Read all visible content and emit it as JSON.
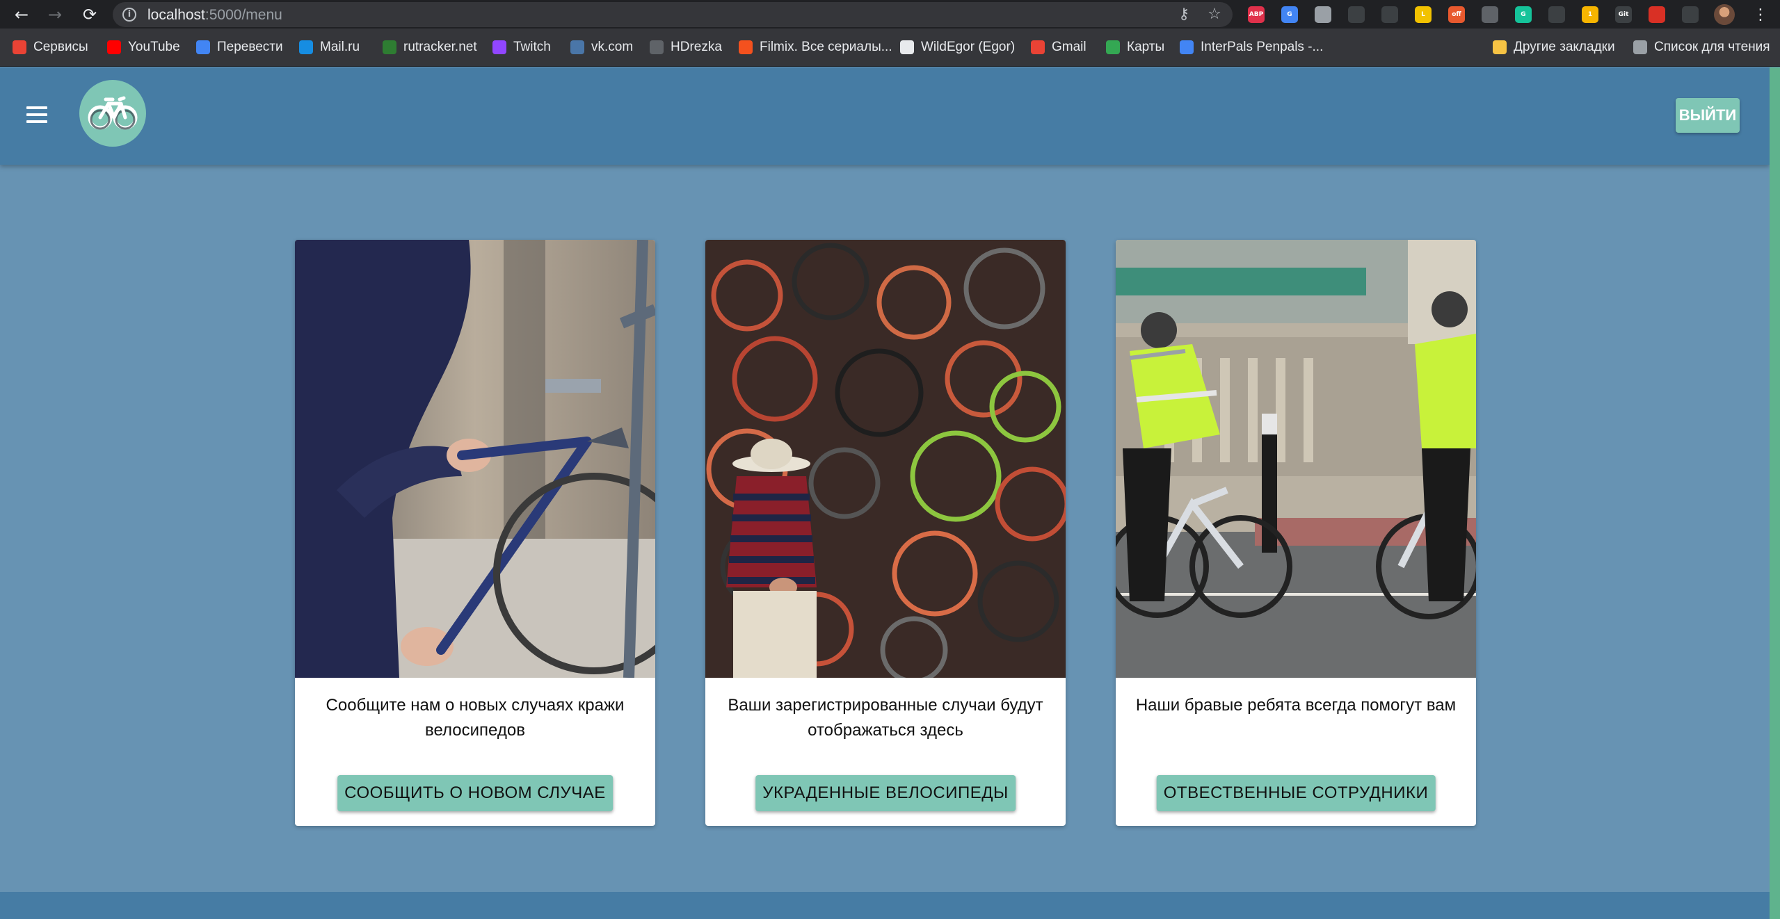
{
  "browser": {
    "url_host": "localhost",
    "url_path": ":5000/menu",
    "extensions": [
      {
        "name": "adblock-plus-icon",
        "label": "ABP",
        "color": "#e0314b"
      },
      {
        "name": "google-translate-icon",
        "label": "G",
        "color": "#4285f4"
      },
      {
        "name": "extension-gray-icon",
        "label": "",
        "color": "#9aa0a6"
      },
      {
        "name": "picture-in-picture-icon",
        "label": "",
        "color": "#3c4043"
      },
      {
        "name": "eyedropper-icon",
        "label": "",
        "color": "#3c4043"
      },
      {
        "name": "l-extension-icon",
        "label": "L",
        "color": "#f2c200"
      },
      {
        "name": "off-extension-icon",
        "label": "off",
        "color": "#e8592e"
      },
      {
        "name": "record-icon",
        "label": "",
        "color": "#5f6368"
      },
      {
        "name": "grammarly-icon",
        "label": "G",
        "color": "#15c39a"
      },
      {
        "name": "reader-icon",
        "label": "",
        "color": "#3c4043"
      },
      {
        "name": "badge-extension-icon",
        "label": "1",
        "color": "#f7b500"
      },
      {
        "name": "gitzip-icon",
        "label": "Git",
        "color": "#3c4043"
      },
      {
        "name": "red-extension-icon",
        "label": "",
        "color": "#d93025"
      },
      {
        "name": "puzzle-icon",
        "label": "",
        "color": "#3c4043"
      }
    ]
  },
  "bookmarks": [
    {
      "name": "bookmark-services",
      "label": "Сервисы",
      "color": "#ea4335"
    },
    {
      "name": "bookmark-youtube",
      "label": "YouTube",
      "color": "#ff0000"
    },
    {
      "name": "bookmark-translate",
      "label": "Перевести",
      "color": "#4285f4"
    },
    {
      "name": "bookmark-mailru",
      "label": "Mail.ru",
      "color": "#168de2"
    },
    {
      "name": "bookmark-rutracker",
      "label": "rutracker.net",
      "color": "#2e7d32"
    },
    {
      "name": "bookmark-twitch",
      "label": "Twitch",
      "color": "#9146ff"
    },
    {
      "name": "bookmark-vk",
      "label": "vk.com",
      "color": "#4a76a8"
    },
    {
      "name": "bookmark-hdrezka",
      "label": "HDrezka",
      "color": "#5f6368"
    },
    {
      "name": "bookmark-filmix",
      "label": "Filmix. Все сериалы...",
      "color": "#f4511e"
    },
    {
      "name": "bookmark-github",
      "label": "WildEgor (Egor)",
      "color": "#e8eaed"
    },
    {
      "name": "bookmark-gmail",
      "label": "Gmail",
      "color": "#ea4335"
    },
    {
      "name": "bookmark-maps",
      "label": "Карты",
      "color": "#34a853"
    },
    {
      "name": "bookmark-interpals",
      "label": "InterPals Penpals -...",
      "color": "#4285f4"
    },
    {
      "name": "bookmark-other",
      "label": "Другие закладки",
      "color": "#f6c344"
    },
    {
      "name": "bookmark-reading-list",
      "label": "Список для чтения",
      "color": "#9aa0a6"
    }
  ],
  "header": {
    "logout_label": "ВЫЙТИ"
  },
  "colors": {
    "accent": "#7fc6b5",
    "header": "#467ca4",
    "background": "#6793b3"
  },
  "cards": [
    {
      "text": "Сообщите нам о новых случаях кражи велосипедов",
      "button": "СООБЩИТЬ О НОВОМ СЛУЧАЕ",
      "image": "bike-theft-photo"
    },
    {
      "text": "Ваши зарегистрированные случаи будут отображаться здесь",
      "button": "УКРАДЕННЫЕ ВЕЛОСИПЕДЫ",
      "image": "bike-pile-photo"
    },
    {
      "text": "Наши бравые ребята всегда помогут вам",
      "button": "ОТВЕСТВЕННЫЕ СОТРУДНИКИ",
      "image": "police-cyclists-photo"
    }
  ]
}
